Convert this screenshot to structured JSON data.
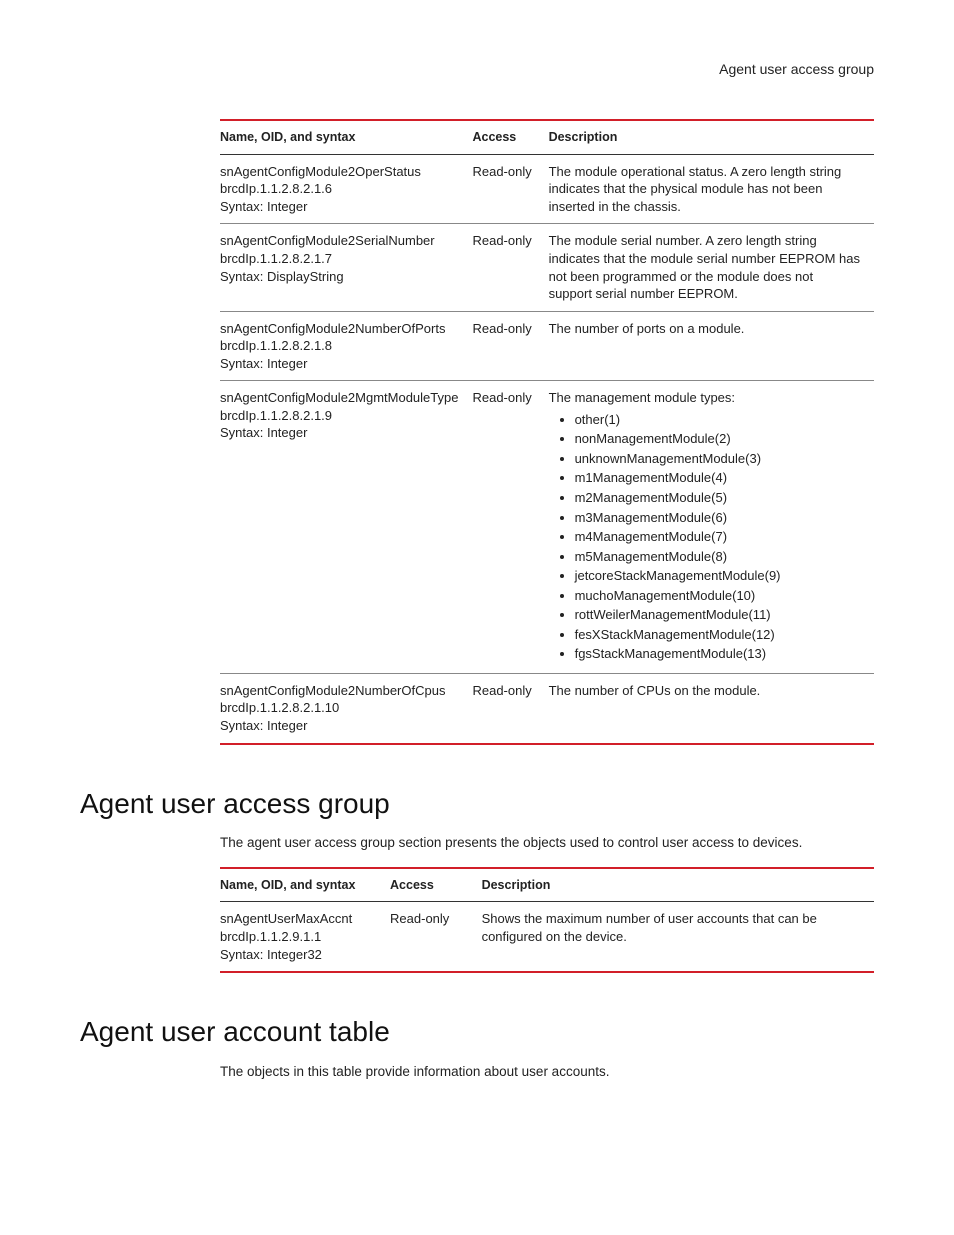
{
  "header": {
    "text": "Agent user access group"
  },
  "table1": {
    "headers": {
      "name": "Name, OID, and syntax",
      "access": "Access",
      "desc": "Description"
    },
    "rows": [
      {
        "name1": "snAgentConfigModule2OperStatus",
        "name2": "brcdIp.1.1.2.8.2.1.6",
        "name3": "Syntax: Integer",
        "access": "Read-only",
        "desc": "The module operational status. A zero length string indicates that the physical module has not been inserted in the chassis."
      },
      {
        "name1": "snAgentConfigModule2SerialNumber",
        "name2": "brcdIp.1.1.2.8.2.1.7",
        "name3": "Syntax: DisplayString",
        "access": "Read-only",
        "desc": "The module serial number. A zero length string indicates that the module serial number EEPROM has not been programmed or the module does not support serial number EEPROM."
      },
      {
        "name1": "snAgentConfigModule2NumberOfPorts",
        "name2": "brcdIp.1.1.2.8.2.1.8",
        "name3": "Syntax: Integer",
        "access": "Read-only",
        "desc": "The number of ports on a module."
      },
      {
        "name1": "snAgentConfigModule2MgmtModuleType",
        "name2": "brcdIp.1.1.2.8.2.1.9",
        "name3": "Syntax: Integer",
        "access": "Read-only",
        "desc_intro": "The management module types:",
        "types": [
          "other(1)",
          "nonManagementModule(2)",
          "unknownManagementModule(3)",
          "m1ManagementModule(4)",
          "m2ManagementModule(5)",
          "m3ManagementModule(6)",
          "m4ManagementModule(7)",
          "m5ManagementModule(8)",
          "jetcoreStackManagementModule(9)",
          "muchoManagementModule(10)",
          "rottWeilerManagementModule(11)",
          "fesXStackManagementModule(12)",
          "fgsStackManagementModule(13)"
        ]
      },
      {
        "name1": "snAgentConfigModule2NumberOfCpus",
        "name2": "brcdIp.1.1.2.8.2.1.10",
        "name3": "Syntax: Integer",
        "access": "Read-only",
        "desc": "The number of CPUs on the module."
      }
    ]
  },
  "section1": {
    "heading": "Agent user access group",
    "intro": "The agent user access group section presents the objects used to control user access to devices."
  },
  "table2": {
    "headers": {
      "name": "Name, OID, and syntax",
      "access": "Access",
      "desc": "Description"
    },
    "rows": [
      {
        "name1": "snAgentUserMaxAccnt",
        "name2": "brcdIp.1.1.2.9.1.1",
        "name3": "Syntax: Integer32",
        "access": "Read-only",
        "desc": "Shows the maximum number of user accounts that can be configured on the device."
      }
    ]
  },
  "section2": {
    "heading": "Agent user account table",
    "intro": "The objects in this table provide information about user accounts."
  }
}
